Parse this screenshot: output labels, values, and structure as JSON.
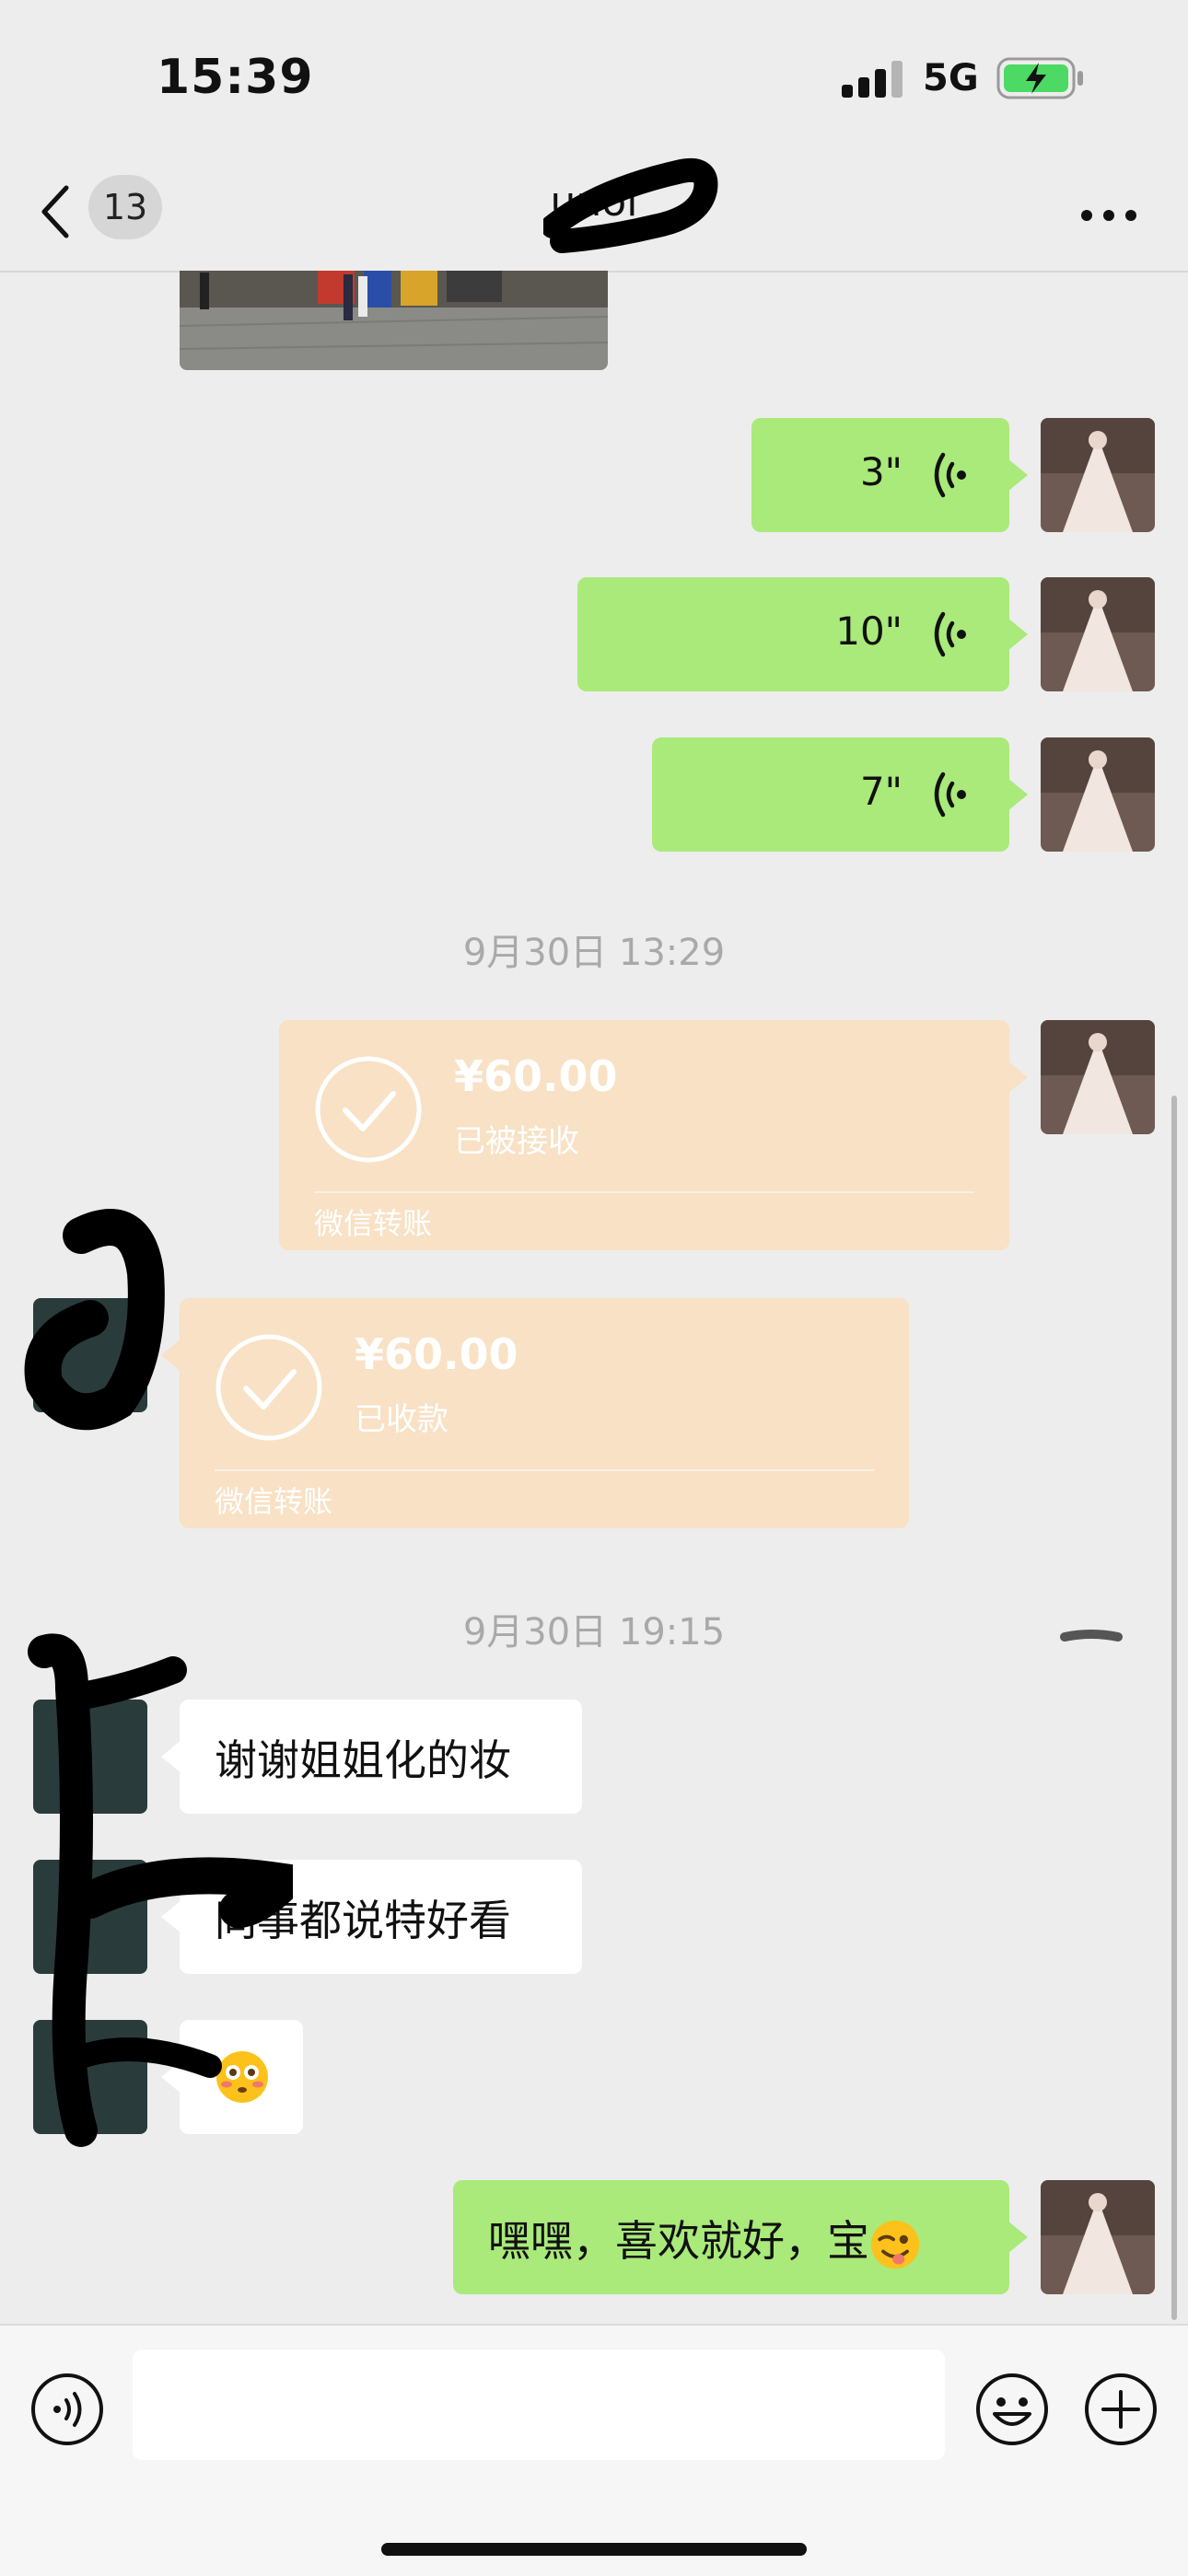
{
  "status_bar": {
    "time": "15:39",
    "network": "5G"
  },
  "nav": {
    "unread_count": "13",
    "contact_name": "unol"
  },
  "messages": {
    "voice": [
      {
        "duration": "3\""
      },
      {
        "duration": "10\""
      },
      {
        "duration": "7\""
      }
    ],
    "timestamp_1": "9月30日 13:29",
    "transfer_sent": {
      "amount": "¥60.00",
      "status": "已被接收",
      "label": "微信转账"
    },
    "transfer_received": {
      "amount": "¥60.00",
      "status": "已收款",
      "label": "微信转账"
    },
    "timestamp_2": "9月30日 19:15",
    "text_1": "谢谢姐姐化的妆",
    "text_2": "同事都说特好看",
    "text_3_emoji": "flushed-face",
    "text_4": "嘿嘿，喜欢就好，宝",
    "text_4_emoji": "winking-face-with-tongue"
  },
  "colors": {
    "my_bubble": "#a9ea7a",
    "other_bubble": "#ffffff",
    "transfer": "#f8e1c5",
    "background": "#ededed"
  },
  "icons": [
    "back-chevron-icon",
    "more-icon",
    "voice-wave-icon",
    "check-circle-icon",
    "voice-input-icon",
    "emoji-icon",
    "plus-icon"
  ]
}
